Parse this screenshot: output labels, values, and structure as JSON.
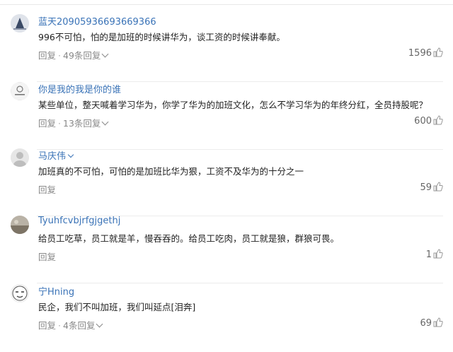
{
  "comments": [
    {
      "username": "蓝天20905936693669366",
      "text": "996不可怕，怕的是加班的时候讲华为，谈工资的时候讲奉献。",
      "reply_label": "回复",
      "replies_label": "49条回复",
      "likes": "1596",
      "avatar_icon": "mountain-avatar-icon"
    },
    {
      "username": "你是我的我是你的谁",
      "text": "某些单位，整天喊着学习华为，你学了华为的加班文化，怎么不学习华为的年终分红，全员持股呢？",
      "reply_label": "回复",
      "replies_label": "13条回复",
      "likes": "600",
      "avatar_icon": "logo-avatar-icon"
    },
    {
      "username": "马庆伟",
      "text": "加班真的不可怕，可怕的是加班比华为狠，工资不及华为的十分之一",
      "reply_label": "回复",
      "replies_label": "",
      "likes": "59",
      "avatar_icon": "default-user-avatar-icon"
    },
    {
      "username": "Tyuhfcvbjrfgjgethj",
      "text": "给员工吃草，员工就是羊，慢吞吞的。给员工吃肉，员工就是狼，群狼可畏。",
      "reply_label": "回复",
      "replies_label": "",
      "likes": "1",
      "avatar_icon": "landscape-avatar-icon"
    },
    {
      "username": "宁Hning",
      "text": "民企，我们不叫加班，我们叫延点[泪奔]",
      "reply_label": "回复",
      "replies_label": "4条回复",
      "likes": "69",
      "avatar_icon": "cartoon-face-avatar-icon"
    }
  ],
  "colors": {
    "username": "#3a73b7",
    "text": "#222222",
    "muted": "#888888"
  }
}
